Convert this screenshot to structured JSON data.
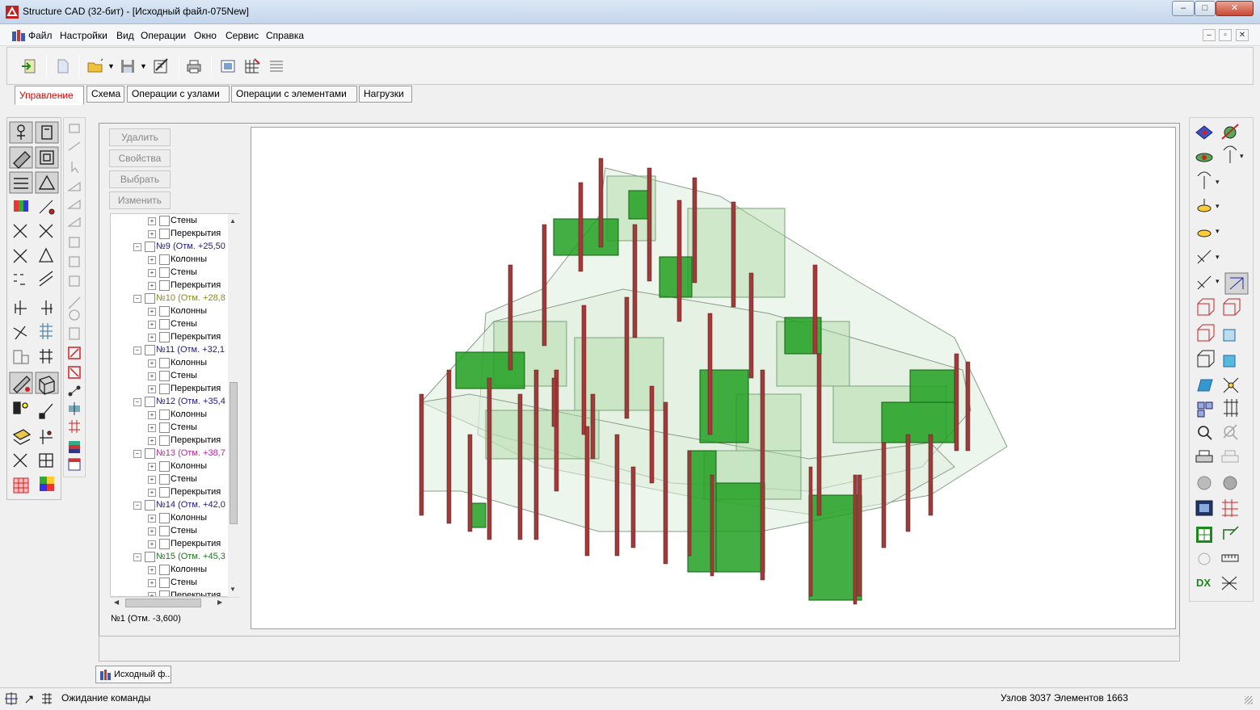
{
  "window": {
    "title": "Structure CAD (32-бит) - [Исходный файл-075New]",
    "controls": {
      "minimize": "–",
      "maximize": "□",
      "close": "✕"
    }
  },
  "menu": [
    "Файл",
    "Настройки",
    "Вид",
    "Операции",
    "Окно",
    "Сервис",
    "Справка"
  ],
  "mdi_controls": {
    "minimize": "–",
    "restore": "▫",
    "close": "✕"
  },
  "tabs": [
    "Управление",
    "Схема",
    "Операции с узлами",
    "Операции с элементами",
    "Нагрузки"
  ],
  "active_tab": "Управление",
  "actions": [
    "Удалить",
    "Свойства",
    "Выбрать",
    "Изменить"
  ],
  "tree": [
    {
      "kind": "sub",
      "label": "Стены"
    },
    {
      "kind": "sub",
      "label": "Перекрытия"
    },
    {
      "kind": "floor",
      "label": "№9 (Отм. +25,50",
      "color": "#1a1a8c"
    },
    {
      "kind": "sub",
      "label": "Колонны"
    },
    {
      "kind": "sub",
      "label": "Стены"
    },
    {
      "kind": "sub",
      "label": "Перекрытия"
    },
    {
      "kind": "floor",
      "label": "№10 (Отм. +28,8",
      "color": "#8a8a1a"
    },
    {
      "kind": "sub",
      "label": "Колонны"
    },
    {
      "kind": "sub",
      "label": "Стены"
    },
    {
      "kind": "sub",
      "label": "Перекрытия"
    },
    {
      "kind": "floor",
      "label": "№11 (Отм. +32,1",
      "color": "#1a1a8c"
    },
    {
      "kind": "sub",
      "label": "Колонны"
    },
    {
      "kind": "sub",
      "label": "Стены"
    },
    {
      "kind": "sub",
      "label": "Перекрытия"
    },
    {
      "kind": "floor",
      "label": "№12 (Отм. +35,4",
      "color": "#1a1a8c"
    },
    {
      "kind": "sub",
      "label": "Колонны"
    },
    {
      "kind": "sub",
      "label": "Стены"
    },
    {
      "kind": "sub",
      "label": "Перекрытия"
    },
    {
      "kind": "floor",
      "label": "№13 (Отм. +38,7",
      "color": "#c01fa0"
    },
    {
      "kind": "sub",
      "label": "Колонны"
    },
    {
      "kind": "sub",
      "label": "Стены"
    },
    {
      "kind": "sub",
      "label": "Перекрытия"
    },
    {
      "kind": "floor",
      "label": "№14 (Отм. +42,0",
      "color": "#1a1a8c"
    },
    {
      "kind": "sub",
      "label": "Колонны"
    },
    {
      "kind": "sub",
      "label": "Стены"
    },
    {
      "kind": "sub",
      "label": "Перекрытия"
    },
    {
      "kind": "floor",
      "label": "№15 (Отм. +45,3",
      "color": "#1a7a1a"
    },
    {
      "kind": "sub",
      "label": "Колонны"
    },
    {
      "kind": "sub",
      "label": "Стены"
    },
    {
      "kind": "sub",
      "label": "Перекрытия"
    }
  ],
  "current_floor": "№1 (Отм. -3,600)",
  "doc_tab": "Исходный ф...",
  "status": {
    "message": "Ожидание команды",
    "counts": "Узлов 3037 Элементов 1663"
  },
  "colors": {
    "columns": "#a33a3a",
    "walls_strong": "#22a022",
    "walls_light": "#cfe8c8",
    "accent_tab": "#dd0000"
  }
}
